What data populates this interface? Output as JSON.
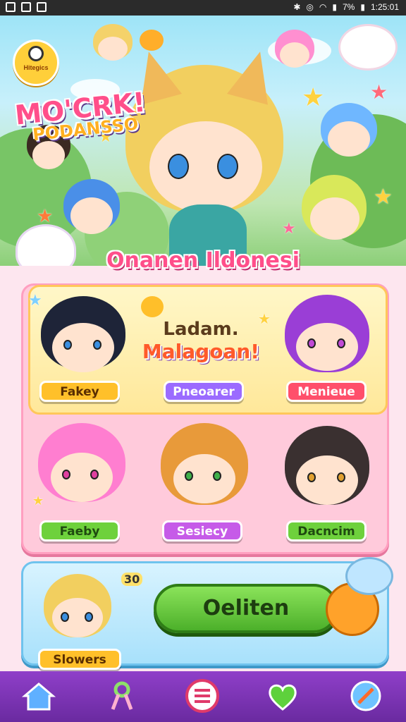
{
  "status_bar": {
    "battery": "7%",
    "time": "1:25:01"
  },
  "hero": {
    "badge_text": "Hitegics",
    "logo_line1": "MO'CRK!",
    "logo_line2": "PODANSSO"
  },
  "section_title": "Onanen Ildonesi",
  "featured": {
    "line1": "Ladam.",
    "line2": "Malagoan!"
  },
  "characters": [
    {
      "label": "Fakey",
      "hair": "#1e2438",
      "eyes": "#3a7be0",
      "color": "yellow"
    },
    {
      "label": "Pneoarer",
      "hair": "",
      "eyes": "",
      "color": "purple"
    },
    {
      "label": "Menieue",
      "hair": "#9a3ed6",
      "eyes": "#c04ad6",
      "color": "red"
    },
    {
      "label": "Faeby",
      "hair": "#ff7ed0",
      "eyes": "#e040a0",
      "color": "green"
    },
    {
      "label": "Sesiecy",
      "hair": "#e89a3a",
      "eyes": "#3fb04a",
      "color": "violet"
    },
    {
      "label": "Dacncim",
      "hair": "#3a3030",
      "eyes": "#e0a030",
      "color": "green"
    }
  ],
  "player": {
    "label": "Slowers",
    "badge": "30"
  },
  "play_button": "Oeliten",
  "nav": [
    "home-icon",
    "ribbon-icon",
    "menu-icon",
    "heart-icon",
    "compass-icon"
  ],
  "colors": {
    "accent": "#ff4f8a",
    "nav_bg": "#7b34b3",
    "play": "#5cc23a"
  }
}
